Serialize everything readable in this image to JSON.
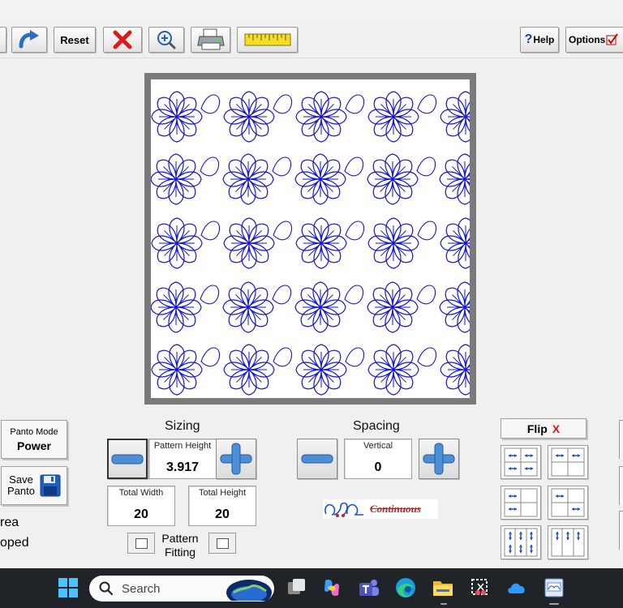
{
  "toolbar": {
    "reset_label": "Reset",
    "help_label": "Help",
    "options_label": "Options"
  },
  "left_panel": {
    "panto_mode_title": "Panto Mode",
    "panto_mode_value": "Power",
    "save_panto_line1": "Save",
    "save_panto_line2": "Panto",
    "partial_text_1": "rea",
    "partial_text_2": "oped"
  },
  "sizing": {
    "title": "Sizing",
    "pattern_height_label": "Pattern Height",
    "pattern_height_value": "3.917",
    "total_width_label": "Total Width",
    "total_width_value": "20",
    "total_height_label": "Total Height",
    "total_height_value": "20",
    "pattern_fitting_line1": "Pattern",
    "pattern_fitting_line2": "Fitting"
  },
  "spacing": {
    "title": "Spacing",
    "vertical_label": "Vertical",
    "vertical_value": "0",
    "continuous_label": "Continuous"
  },
  "flip": {
    "label": "Flip",
    "mark": "X"
  },
  "taskbar": {
    "search_placeholder": "Search"
  },
  "colors": {
    "pattern_blue": "#1515d6",
    "flip_red": "#e01818",
    "preview_frame": "#7a7a7a",
    "taskbar_bg": "#202428"
  }
}
